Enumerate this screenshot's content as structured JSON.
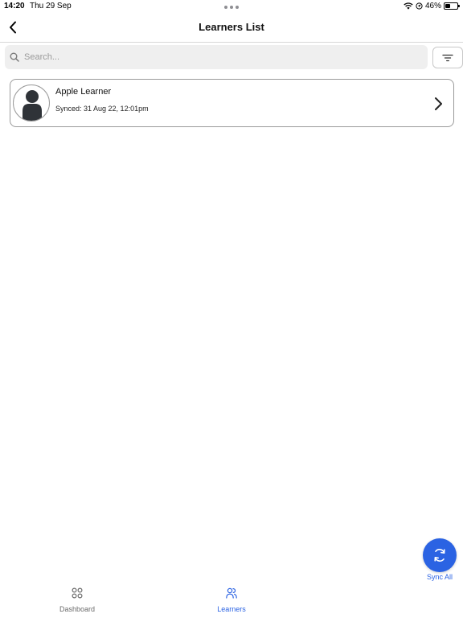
{
  "status_bar": {
    "time": "14:20",
    "date": "Thu 29 Sep",
    "battery": "46%",
    "battery_level": 0.46
  },
  "header": {
    "title": "Learners List",
    "back_icon": "chevron-left-icon"
  },
  "search": {
    "placeholder": "Search...",
    "value": "",
    "icon": "search-icon"
  },
  "filter": {
    "icon": "filter-icon"
  },
  "learners": [
    {
      "name": "Apple Learner",
      "synced": "Synced: 31 Aug 22, 12:01pm",
      "avatar_icon": "person-icon"
    }
  ],
  "sync_all": {
    "label": "Sync All",
    "icon": "sync-icon"
  },
  "tabs": [
    {
      "label": "Dashboard",
      "icon": "grid-icon",
      "active": false
    },
    {
      "label": "Learners",
      "icon": "users-icon",
      "active": true
    }
  ],
  "colors": {
    "accent": "#2b63e3",
    "inactive_tab": "#6b6b6b",
    "search_bg": "#efefef",
    "avatar_fill": "#2f3338"
  }
}
